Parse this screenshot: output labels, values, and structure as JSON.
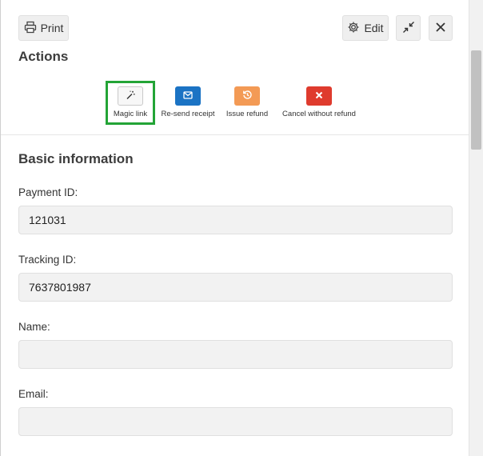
{
  "toolbar": {
    "print_label": "Print",
    "edit_label": "Edit"
  },
  "actions": {
    "title": "Actions",
    "items": [
      {
        "label": "Magic link",
        "icon": "magic-wand-icon",
        "color": "#f7f7f7"
      },
      {
        "label": "Re-send receipt",
        "icon": "envelope-icon",
        "color": "#1b73c4"
      },
      {
        "label": "Issue refund",
        "icon": "undo-icon",
        "color": "#f39a55"
      },
      {
        "label": "Cancel without refund",
        "icon": "x-icon",
        "color": "#df3b2e"
      }
    ],
    "highlight_color": "#23a436"
  },
  "basic_info": {
    "title": "Basic information",
    "fields": [
      {
        "label": "Payment ID:",
        "value": "121031"
      },
      {
        "label": "Tracking ID:",
        "value": "7637801987"
      },
      {
        "label": "Name:",
        "value": ""
      },
      {
        "label": "Email:",
        "value": ""
      }
    ]
  }
}
